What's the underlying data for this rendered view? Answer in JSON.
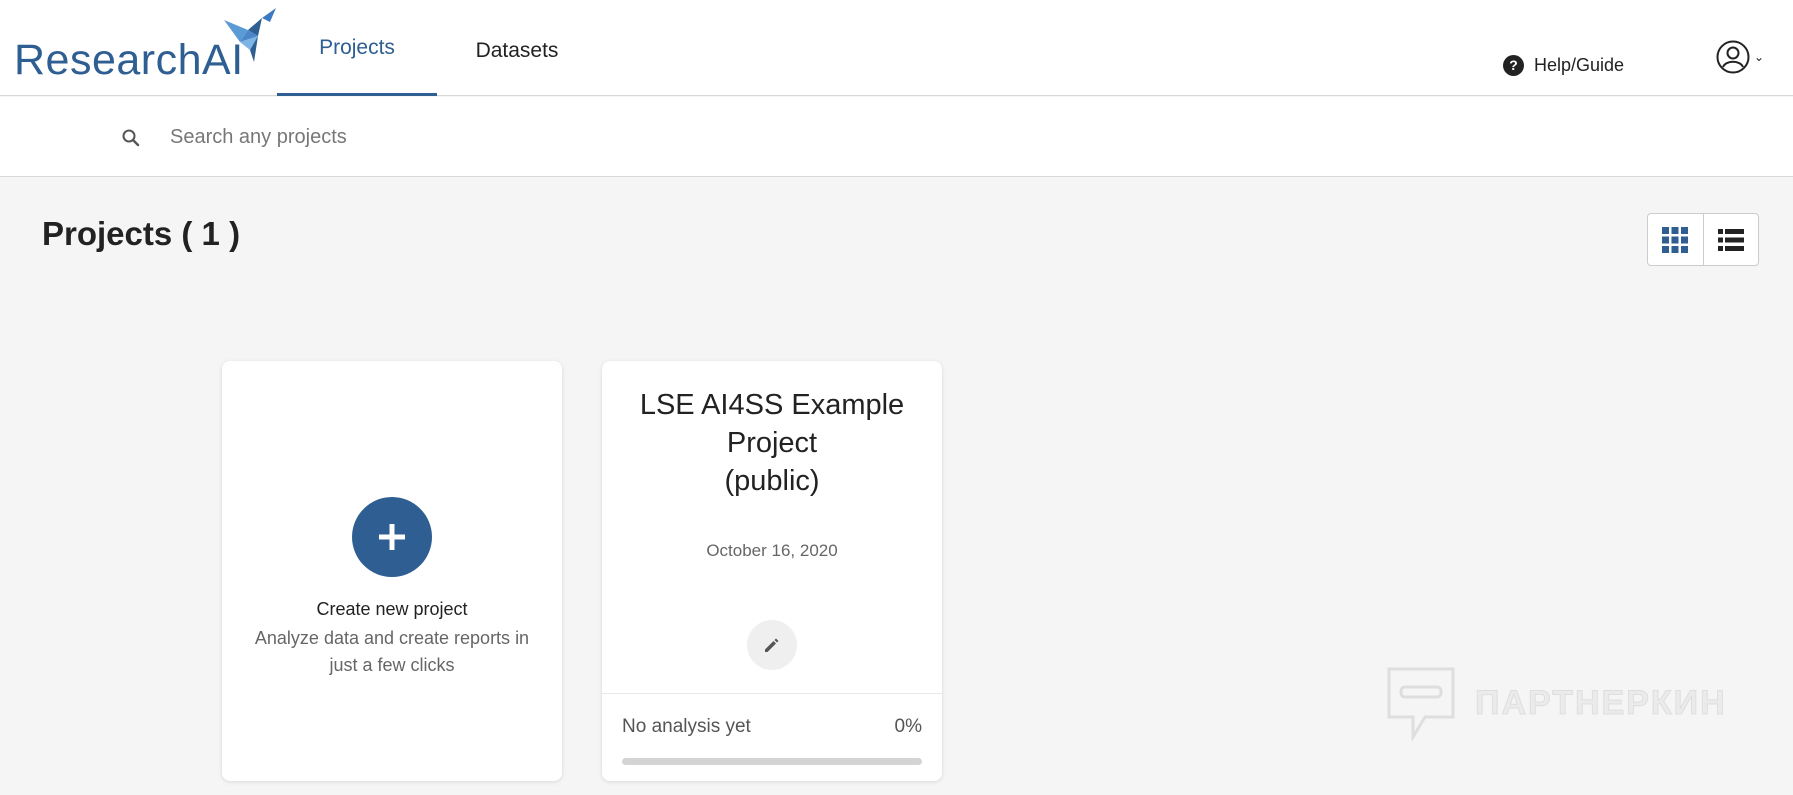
{
  "header": {
    "logo_text": "ResearchAI",
    "tabs": [
      {
        "label": "Projects",
        "active": true
      },
      {
        "label": "Datasets",
        "active": false
      }
    ],
    "help_label": "Help/Guide"
  },
  "search": {
    "placeholder": "Search any projects",
    "value": ""
  },
  "main": {
    "title": "Projects ( 1 )",
    "view_modes": [
      "grid",
      "list"
    ],
    "active_view": "grid"
  },
  "create_card": {
    "title": "Create new project",
    "description": "Analyze data and create reports in just a few clicks"
  },
  "projects": [
    {
      "title": "LSE AI4SS Example Project (public)",
      "date": "October 16, 2020",
      "status": "No analysis yet",
      "progress_label": "0%",
      "progress": 0
    }
  ],
  "watermark": "ПАРТНЕРКИН",
  "colors": {
    "accent": "#2f5e92",
    "background": "#f5f5f5",
    "card": "#ffffff"
  }
}
